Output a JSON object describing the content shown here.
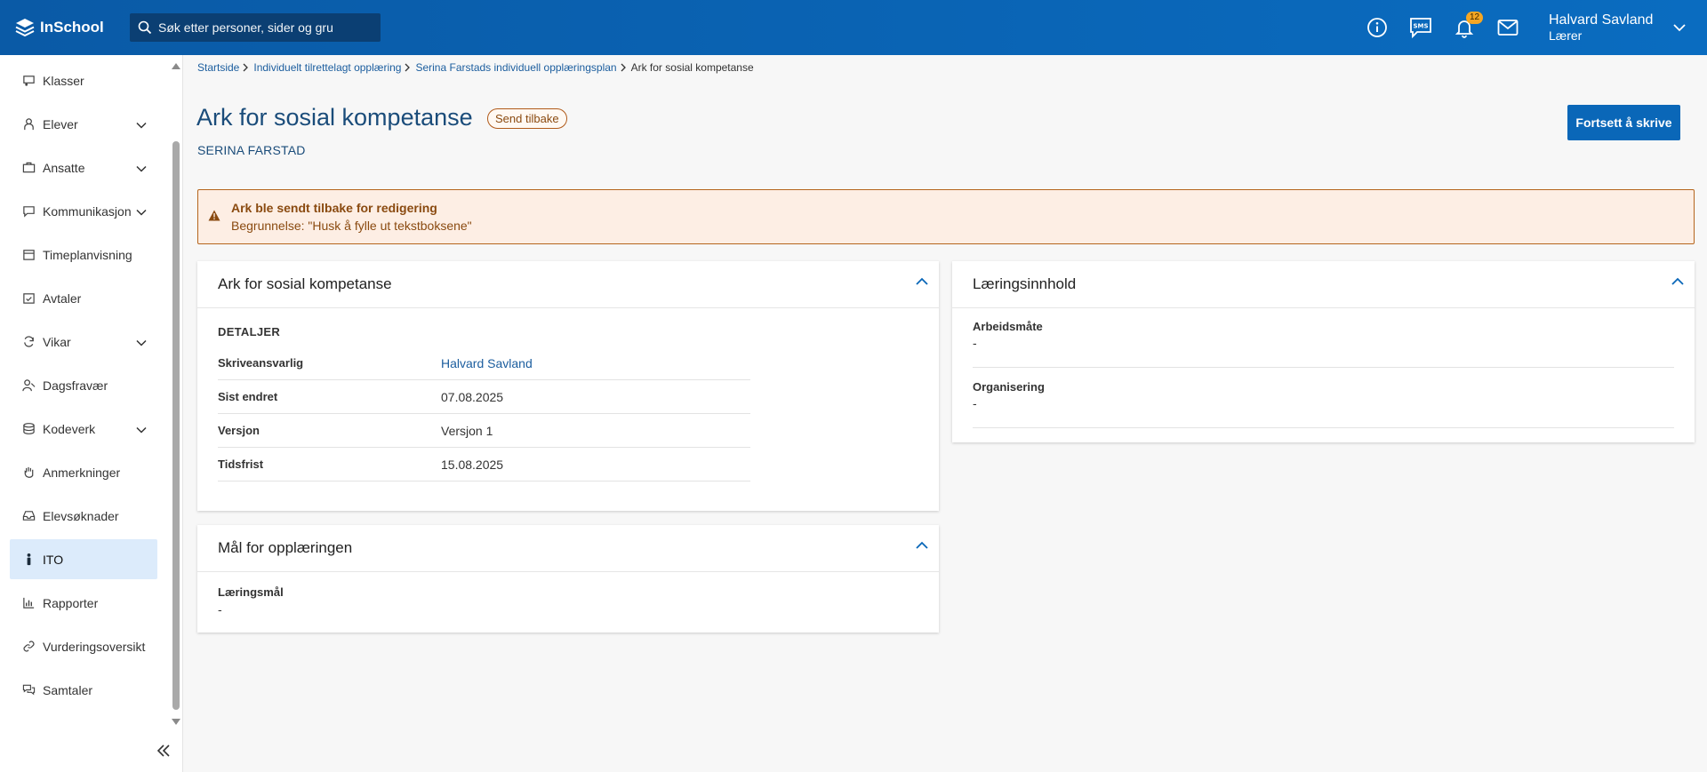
{
  "app": {
    "logo_text": "InSchool",
    "search_placeholder": "Søk etter personer, sider og gru",
    "notification_count": "12",
    "user_name": "Halvard Savland",
    "user_role": "Lærer"
  },
  "sidebar": {
    "items": [
      {
        "label": "Klasser",
        "icon": "class-icon",
        "expandable": false
      },
      {
        "label": "Elever",
        "icon": "students-icon",
        "expandable": true
      },
      {
        "label": "Ansatte",
        "icon": "briefcase-icon",
        "expandable": true
      },
      {
        "label": "Kommunikasjon",
        "icon": "chat-icon",
        "expandable": true
      },
      {
        "label": "Timeplanvisning",
        "icon": "calendar-icon",
        "expandable": false
      },
      {
        "label": "Avtaler",
        "icon": "calendar-check-icon",
        "expandable": false
      },
      {
        "label": "Vikar",
        "icon": "refresh-icon",
        "expandable": true
      },
      {
        "label": "Dagsfravær",
        "icon": "person-absence-icon",
        "expandable": false
      },
      {
        "label": "Kodeverk",
        "icon": "database-icon",
        "expandable": true
      },
      {
        "label": "Anmerkninger",
        "icon": "hand-icon",
        "expandable": false
      },
      {
        "label": "Elevsøknader",
        "icon": "inbox-icon",
        "expandable": false
      },
      {
        "label": "ITO",
        "icon": "person-icon",
        "expandable": false,
        "active": true
      },
      {
        "label": "Rapporter",
        "icon": "chart-icon",
        "expandable": false
      },
      {
        "label": "Vurderingsoversikt",
        "icon": "link-icon",
        "expandable": false
      },
      {
        "label": "Samtaler",
        "icon": "conversation-icon",
        "expandable": false
      }
    ]
  },
  "breadcrumb": [
    "Startside",
    "Individuelt tilrettelagt opplæring",
    "Serina Farstads individuell opplæringsplan",
    "Ark for sosial kompetanse"
  ],
  "page": {
    "title": "Ark for sosial kompetanse",
    "status": "Send tilbake",
    "student": "SERINA FARSTAD",
    "primary_button": "Fortsett å skrive"
  },
  "alert": {
    "title": "Ark ble sendt tilbake for redigering",
    "text": "Begrunnelse: \"Husk å fylle ut tekstboksene\""
  },
  "card_details": {
    "title": "Ark for sosial kompetanse",
    "section": "DETALJER",
    "rows": [
      {
        "key": "Skriveansvarlig",
        "value": "Halvard Savland"
      },
      {
        "key": "Sist endret",
        "value": "07.08.2025"
      },
      {
        "key": "Versjon",
        "value": "Versjon 1"
      },
      {
        "key": "Tidsfrist",
        "value": "15.08.2025"
      }
    ]
  },
  "card_goals": {
    "title": "Mål for opplæringen",
    "field_label": "Læringsmål",
    "field_value": "-"
  },
  "card_content": {
    "title": "Læringsinnhold",
    "fields": [
      {
        "label": "Arbeidsmåte",
        "value": "-"
      },
      {
        "label": "Organisering",
        "value": "-"
      }
    ]
  },
  "colors": {
    "topbar": "#0a5aa6",
    "accent": "#0a67b8",
    "alert_bg": "#fdeee4",
    "alert_border": "#b5651d",
    "active_nav": "#dcebfb"
  }
}
